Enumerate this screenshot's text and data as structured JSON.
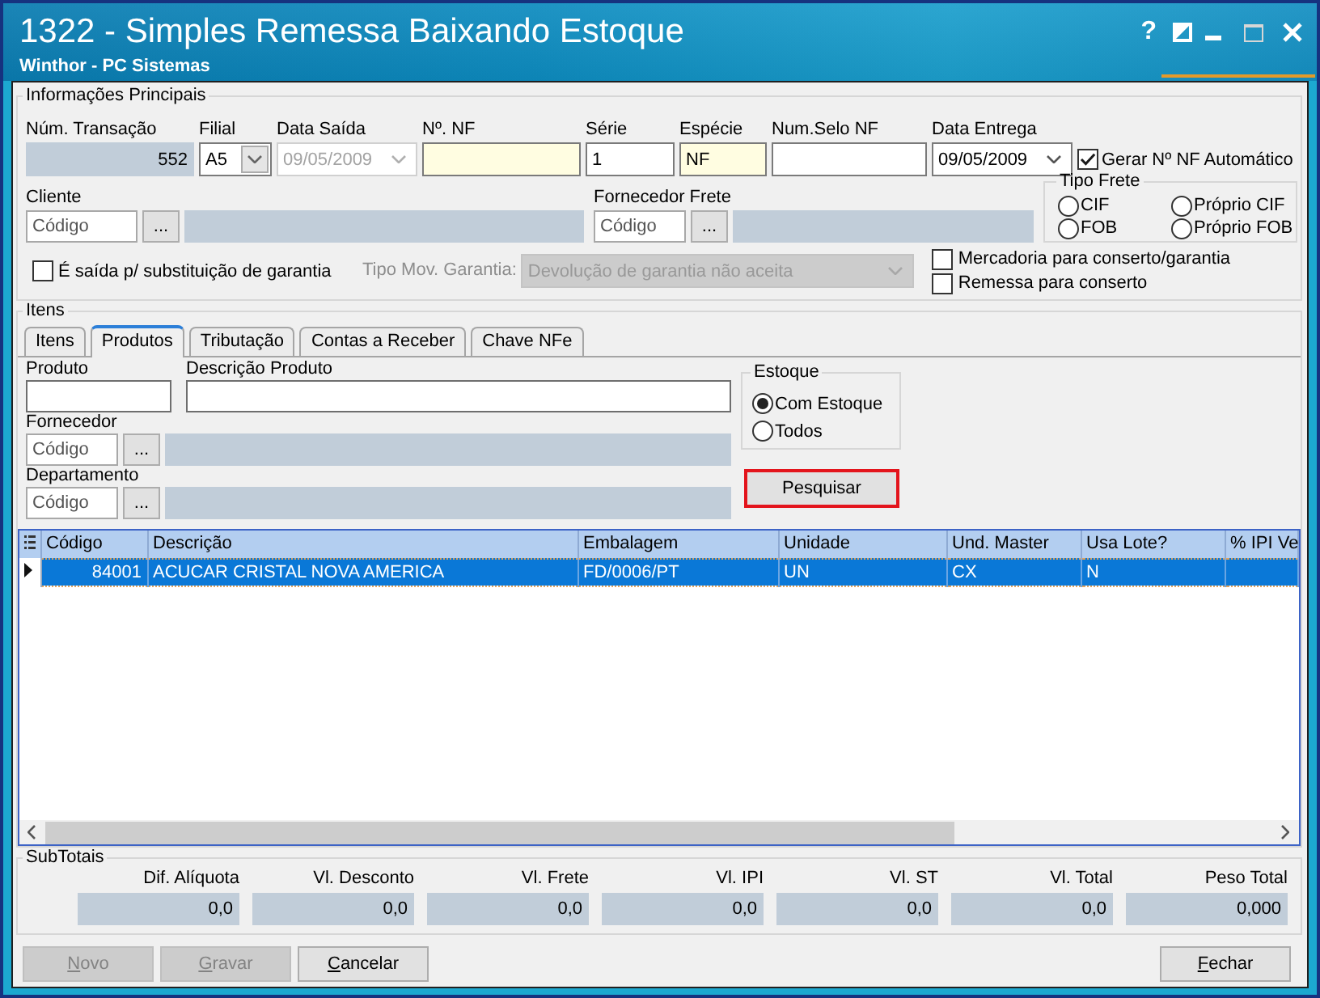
{
  "window": {
    "title": "1322 - Simples Remessa Baixando Estoque",
    "subtitle": "Winthor - PC Sistemas",
    "help": "?"
  },
  "main_info": {
    "title": "Informações Principais",
    "fields": [
      {
        "kind": "readonly",
        "label": "Núm. Transação",
        "value": "552"
      },
      {
        "kind": "combo",
        "label": "Filial",
        "value": "A5",
        "disabled": false
      },
      {
        "kind": "date",
        "label": "Data Saída",
        "value": "09/05/2009",
        "disabled": true
      },
      {
        "kind": "text",
        "label": "Nº. NF",
        "required": true
      },
      {
        "kind": "text",
        "label": "Série",
        "value": "1",
        "required": false
      },
      {
        "kind": "text",
        "label": "Espécie",
        "value": "NF",
        "required": true
      },
      {
        "kind": "text",
        "label": "Num.Selo NF",
        "required": false
      },
      {
        "kind": "date",
        "label": "Data Entrega",
        "value": "09/05/2009",
        "disabled": false
      }
    ],
    "auto_nf": {
      "label": "Gerar Nº NF Automático",
      "checked": true
    },
    "lookups": [
      {
        "label": "Cliente",
        "placeholder": "Código",
        "button": "..."
      },
      {
        "label": "Fornecedor Frete",
        "placeholder": "Código",
        "button": "..."
      }
    ],
    "freight": {
      "title": "Tipo Frete",
      "options": [
        {
          "label": "CIF",
          "selected": false
        },
        {
          "label": "Próprio CIF",
          "selected": false
        },
        {
          "label": "FOB",
          "selected": false
        },
        {
          "label": "Próprio FOB",
          "selected": false
        }
      ]
    },
    "warranty": {
      "label": "É saída p/ substituição de garantia",
      "checked": false
    },
    "warranty_type": {
      "label": "Tipo Mov. Garantia:",
      "value": "Devolução de garantia não aceita",
      "disabled": true
    },
    "options": [
      {
        "label": "Mercadoria para conserto/garantia",
        "checked": false
      },
      {
        "label": "Remessa para conserto",
        "checked": false
      }
    ]
  },
  "items": {
    "title": "Itens",
    "tabs": [
      {
        "label": "Itens",
        "selected": false
      },
      {
        "label": "Produtos",
        "selected": true
      },
      {
        "label": "Tributação",
        "selected": false
      },
      {
        "label": "Contas a Receber",
        "selected": false
      },
      {
        "label": "Chave NFe",
        "selected": false
      }
    ],
    "filters": {
      "product": {
        "label": "Produto"
      },
      "description": {
        "label": "Descrição Produto"
      },
      "lookups": [
        {
          "label": "Fornecedor",
          "placeholder": "Código",
          "button": "..."
        },
        {
          "label": "Departamento",
          "placeholder": "Código",
          "button": "..."
        }
      ],
      "stock": {
        "title": "Estoque",
        "options": [
          {
            "label": "Com Estoque",
            "selected": true
          },
          {
            "label": "Todos",
            "selected": false
          }
        ]
      },
      "search_button": {
        "label": "Pesquisar",
        "highlighted": true
      }
    },
    "table": {
      "columns": [
        "Código",
        "Descrição",
        "Embalagem",
        "Unidade",
        "Und. Master",
        "Usa Lote?",
        "% IPI Ve"
      ],
      "rows": [
        {
          "selected": true,
          "cells": [
            "84001",
            "ACUCAR CRISTAL NOVA AMERICA",
            "FD/0006/PT",
            "UN",
            "CX",
            "N"
          ]
        }
      ]
    }
  },
  "subtotals": {
    "title": "SubTotais",
    "items": [
      {
        "label": "Dif. Alíquota",
        "value": "0,0"
      },
      {
        "label": "Vl. Desconto",
        "value": "0,0"
      },
      {
        "label": "Vl. Frete",
        "value": "0,0"
      },
      {
        "label": "Vl. IPI",
        "value": "0,0"
      },
      {
        "label": "Vl. ST",
        "value": "0,0"
      },
      {
        "label": "Vl. Total",
        "value": "0,0"
      },
      {
        "label": "Peso Total",
        "value": "0,000"
      }
    ]
  },
  "footer": {
    "buttons": [
      {
        "label": "Novo",
        "disabled": true
      },
      {
        "label": "Gravar",
        "disabled": true
      },
      {
        "label": "Cancelar",
        "disabled": false
      }
    ],
    "close_button": {
      "label": "Fechar",
      "disabled": false
    }
  }
}
